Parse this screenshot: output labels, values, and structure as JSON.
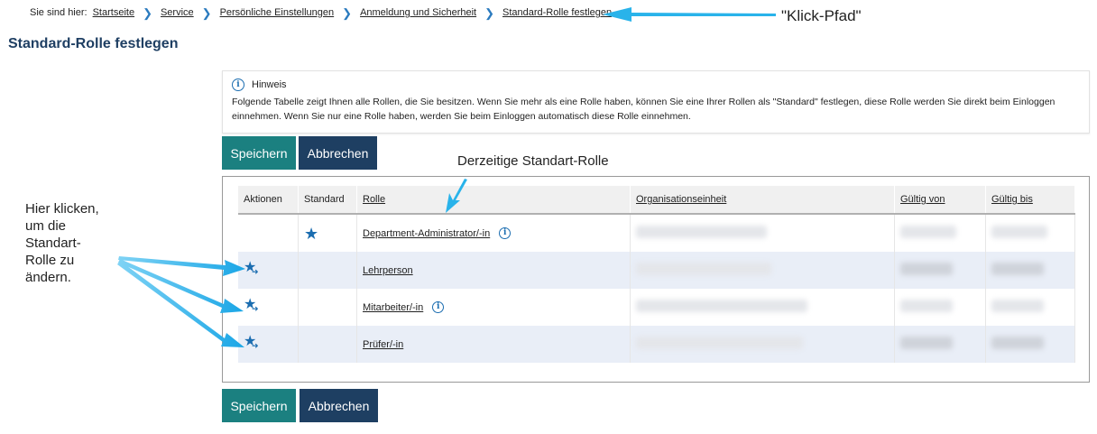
{
  "breadcrumb": {
    "prefix": "Sie sind hier:",
    "items": [
      "Startseite",
      "Service",
      "Persönliche Einstellungen",
      "Anmeldung und Sicherheit",
      "Standard-Rolle festlegen"
    ]
  },
  "page_title": "Standard-Rolle festlegen",
  "hint": {
    "title": "Hinweis",
    "text": "Folgende Tabelle zeigt Ihnen alle Rollen, die Sie besitzen. Wenn Sie mehr als eine Rolle haben, können Sie eine Ihrer Rollen als \"Standard\" festlegen, diese Rolle werden Sie direkt beim Einloggen einnehmen. Wenn Sie nur eine Rolle haben, werden Sie beim Einloggen automatisch diese Rolle einnehmen."
  },
  "buttons": {
    "save": "Speichern",
    "cancel": "Abbrechen"
  },
  "table": {
    "headers": [
      "Aktionen",
      "Standard",
      "Rolle",
      "Organisationseinheit",
      "Gültig von",
      "Gültig bis"
    ],
    "rows": [
      {
        "role": "Department-Administrator/-in",
        "is_default": true,
        "info": true
      },
      {
        "role": "Lehrperson",
        "is_default": false,
        "info": false
      },
      {
        "role": "Mitarbeiter/-in",
        "is_default": false,
        "info": true
      },
      {
        "role": "Prüfer/-in",
        "is_default": false,
        "info": false
      }
    ]
  },
  "annotations": {
    "click_path": "\"Klick-Pfad\"",
    "current_default": "Derzeitige Standart-Rolle",
    "click_here_lines": [
      "Hier klicken,",
      "um die",
      "Standart-",
      "Rolle zu",
      "ändern."
    ]
  },
  "colors": {
    "accent_blue": "#1b6db0",
    "save_teal": "#1b8080",
    "cancel_navy": "#1e3f62",
    "arrow_blue": "#29b3ea"
  },
  "icons": {
    "info": "info-circle-icon",
    "star": "star-icon",
    "set_default": "star-arrow-icon"
  }
}
